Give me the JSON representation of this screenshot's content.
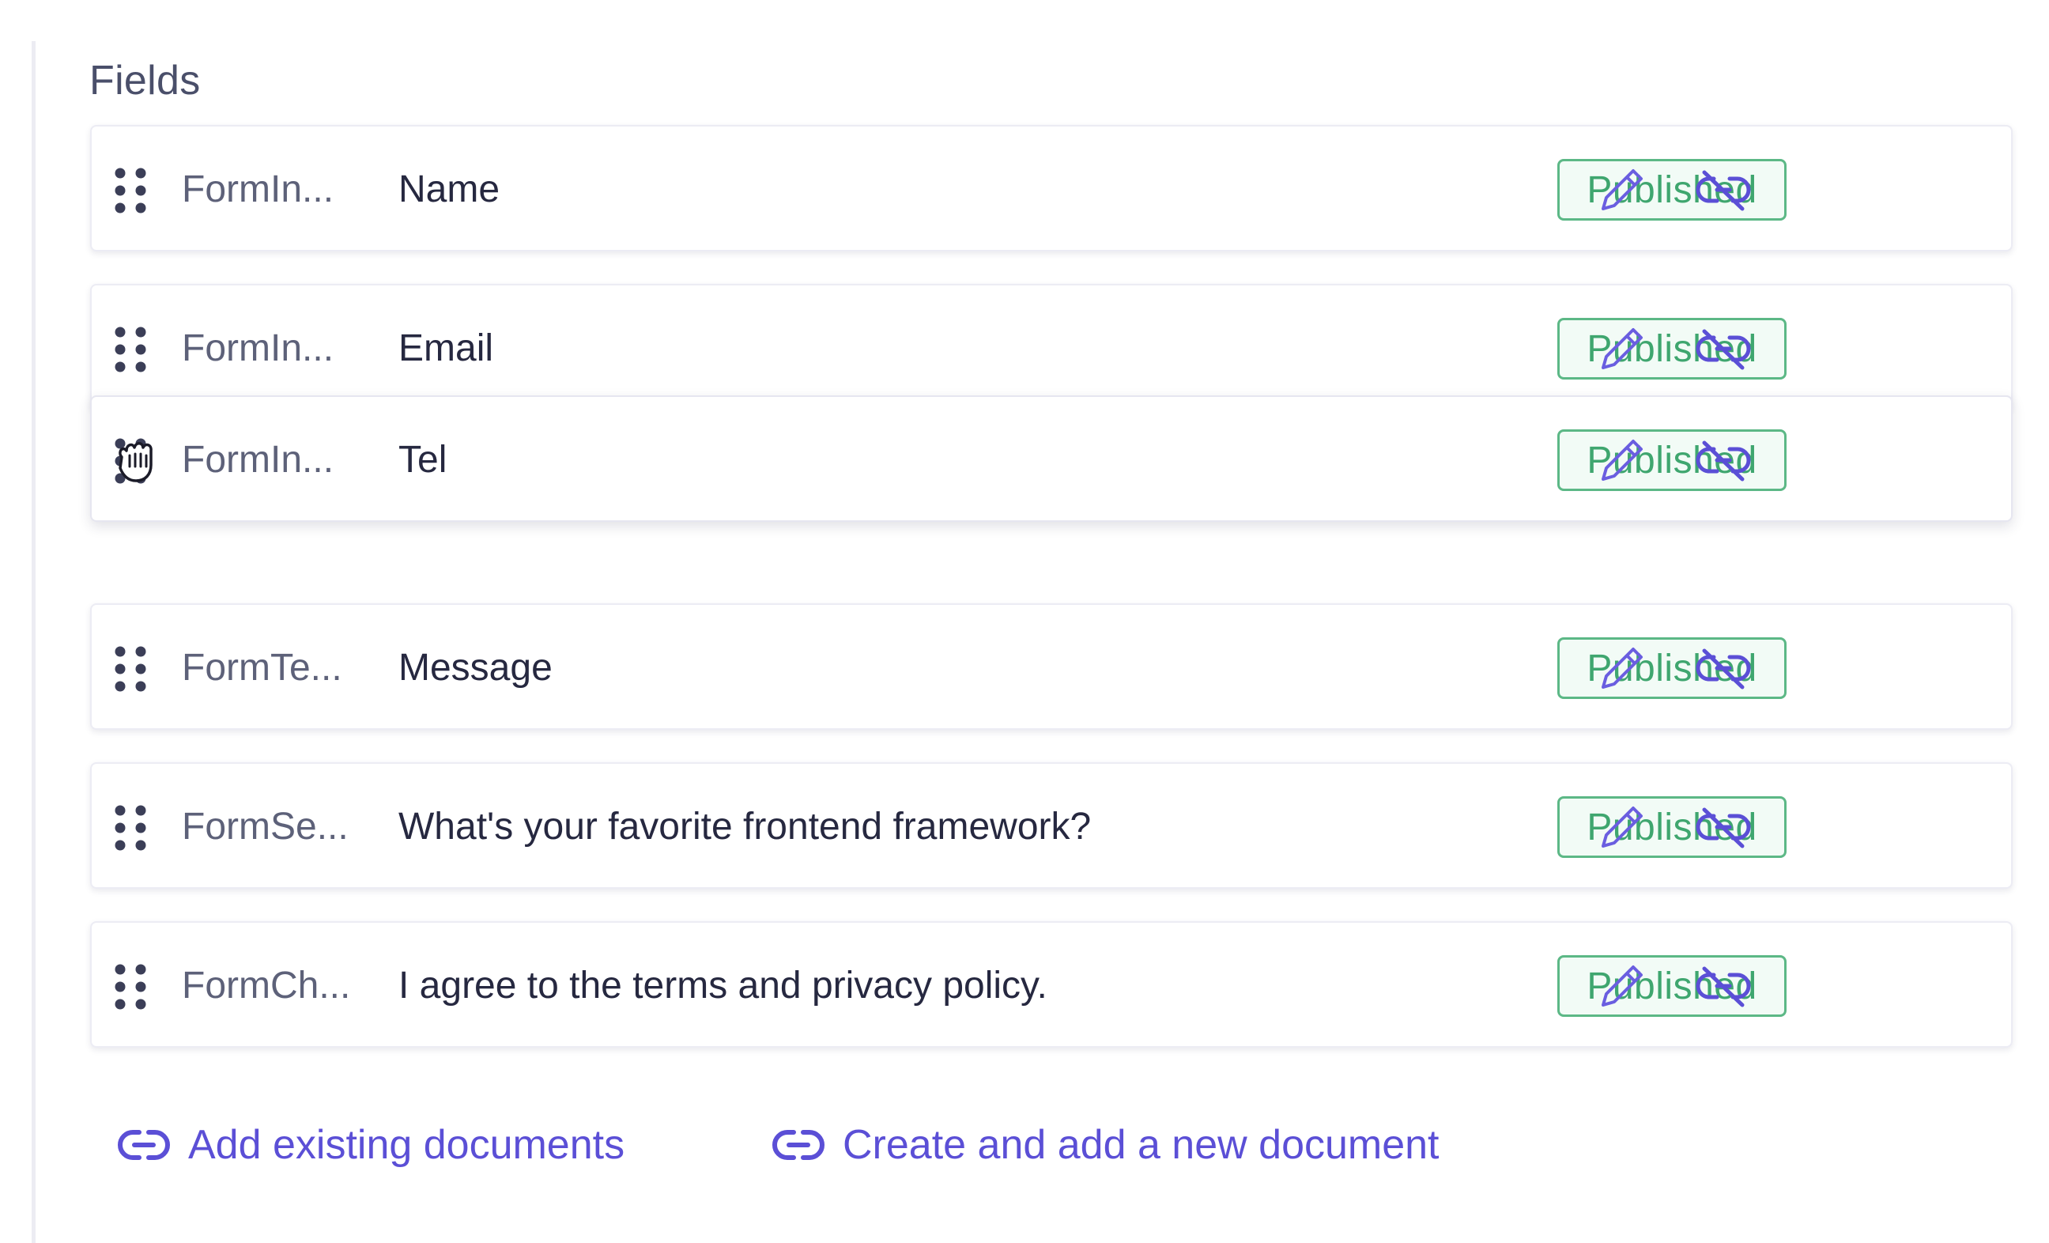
{
  "section": {
    "title": "Fields"
  },
  "status_color": "#3fa66f",
  "accent_color": "#5b4fd6",
  "rows": [
    {
      "type": "FormIn...",
      "label": "Name",
      "status": "Published"
    },
    {
      "type": "FormIn...",
      "label": "Email",
      "status": "Published"
    },
    {
      "type": "FormIn...",
      "label": "Tel",
      "status": "Published",
      "dragging": true
    },
    {
      "type": "FormTe...",
      "label": "Message",
      "status": "Published"
    },
    {
      "type": "FormSe...",
      "label": "What's your favorite frontend framework?",
      "status": "Published"
    },
    {
      "type": "FormCh...",
      "label": "I agree to the terms and privacy policy.",
      "status": "Published"
    }
  ],
  "icons": {
    "handle": "drag-handle-icon",
    "edit": "pencil-icon",
    "unlink": "unlink-icon",
    "cursor": "grab-hand-cursor-icon",
    "link": "link-icon"
  },
  "actions": {
    "add_existing": "Add existing documents",
    "create_new": "Create and add a new document"
  }
}
